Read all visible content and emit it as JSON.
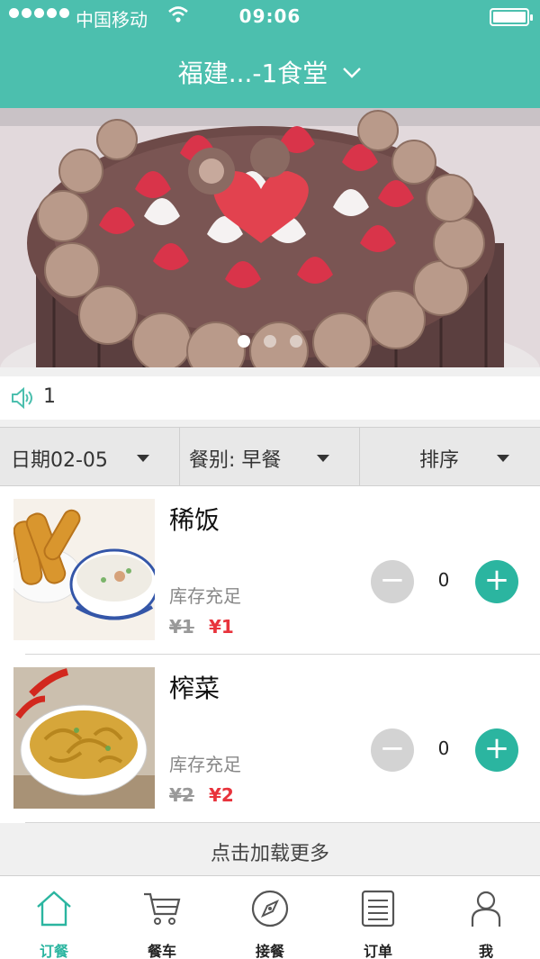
{
  "status_bar": {
    "carrier": "中国移动",
    "time": "09:06"
  },
  "nav": {
    "title": "福建...-1食堂",
    "chevron_icon": "chevron-down-icon"
  },
  "banner": {
    "image": "cake-photo",
    "page_count": 3,
    "active_page": 1
  },
  "notice": {
    "icon": "speaker-icon",
    "text": "1"
  },
  "filters": {
    "date": "日期02-05",
    "meal": "餐别: 早餐",
    "sort": "排序"
  },
  "items": [
    {
      "name": "稀饭",
      "stock": "库存充足",
      "price_old": "¥1",
      "price_new": "¥1",
      "quantity": "0",
      "image": "congee-with-fried-dough-photo"
    },
    {
      "name": "榨菜",
      "stock": "库存充足",
      "price_old": "¥2",
      "price_new": "¥2",
      "quantity": "0",
      "image": "pickled-mustard-photo"
    }
  ],
  "load_more": "点击加载更多",
  "tabs": [
    {
      "label": "订餐",
      "icon": "home-icon",
      "active": true
    },
    {
      "label": "餐车",
      "icon": "cart-icon",
      "active": false
    },
    {
      "label": "接餐",
      "icon": "compass-icon",
      "active": false
    },
    {
      "label": "订单",
      "icon": "list-icon",
      "active": false
    },
    {
      "label": "我",
      "icon": "person-icon",
      "active": false
    }
  ],
  "colors": {
    "primary": "#4cbfae",
    "accent_button": "#2bb5a0",
    "price_red": "#e8333c"
  }
}
